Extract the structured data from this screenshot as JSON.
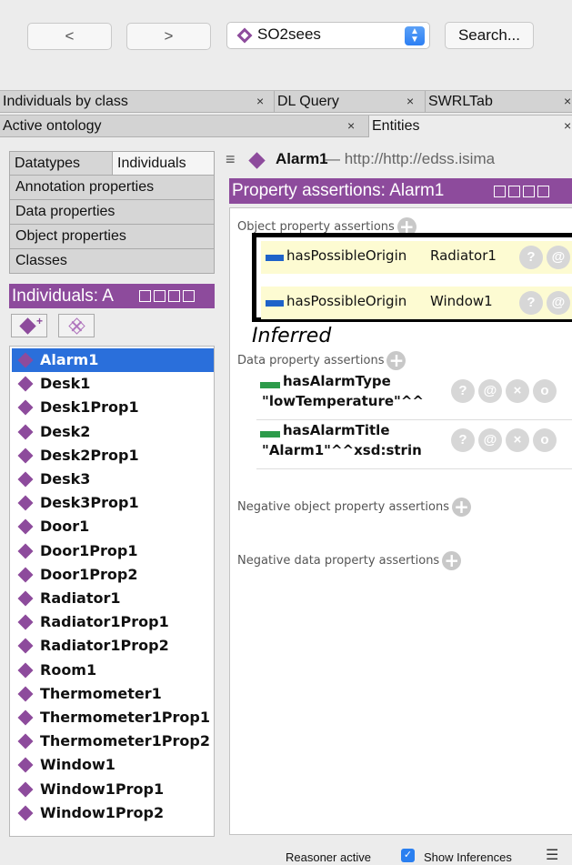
{
  "toolbar": {
    "back_label": "<",
    "forward_label": ">",
    "ontology_selected": "SO2sees",
    "search_label": "Search..."
  },
  "tabs_row1": [
    {
      "label": "Individuals by class",
      "close": "×"
    },
    {
      "label": "DL Query",
      "close": "×"
    },
    {
      "label": "SWRLTab",
      "close": "×"
    }
  ],
  "tabs_row2": [
    {
      "label": "Active ontology",
      "close": "×"
    },
    {
      "label": "Entities",
      "close": "×"
    }
  ],
  "left": {
    "tabs": [
      "Datatypes",
      "Individuals"
    ],
    "rows": [
      "Annotation properties",
      "Data properties",
      "Object properties",
      "Classes"
    ],
    "individuals_header": "Individuals: A",
    "individuals": [
      "Alarm1",
      "Desk1",
      "Desk1Prop1",
      "Desk2",
      "Desk2Prop1",
      "Desk3",
      "Desk3Prop1",
      "Door1",
      "Door1Prop1",
      "Door1Prop2",
      "Radiator1",
      "Radiator1Prop1",
      "Radiator1Prop2",
      "Room1",
      "Thermometer1",
      "Thermometer1Prop1",
      "Thermometer1Prop2",
      "Window1",
      "Window1Prop1",
      "Window1Prop2"
    ],
    "selected": "Alarm1"
  },
  "entity": {
    "menu": "≡",
    "name": "Alarm1",
    "iri": "— http://http://edss.isima"
  },
  "property_assertions": {
    "header": "Property assertions: Alarm1",
    "object_label": "Object property assertions",
    "object": [
      {
        "property": "hasPossibleOrigin",
        "value": "Radiator1"
      },
      {
        "property": "hasPossibleOrigin",
        "value": "Window1"
      }
    ],
    "inferred_label": "Inferred",
    "data_label": "Data property assertions",
    "data": [
      {
        "property": "hasAlarmType",
        "value": "\"lowTemperature\"^^"
      },
      {
        "property": "hasAlarmTitle",
        "value": "\"Alarm1\"^^xsd:strin"
      }
    ],
    "negative_object_label": "Negative object property assertions",
    "negative_data_label": "Negative data property assertions",
    "icons": {
      "help": "?",
      "annotate": "@",
      "delete": "×",
      "edit": "o"
    }
  },
  "status": {
    "reasoner": "Reasoner active",
    "show_inferences": "Show Inferences",
    "show_inferences_checked": true
  },
  "colors": {
    "individual_purple": "#8d4b9c",
    "selection_blue": "#2a6fdb",
    "object_prop_blue": "#1e62c9",
    "data_prop_green": "#2d9b4a",
    "inferred_yellow": "#fdfbd2"
  }
}
